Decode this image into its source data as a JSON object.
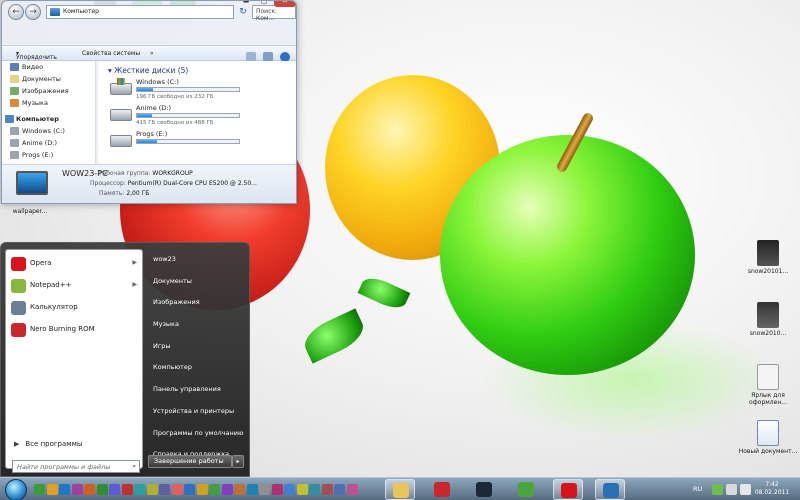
{
  "explorer": {
    "address": "Компьютер",
    "search_placeholder": "Поиск: Ком...",
    "back_glyph": "←",
    "forward_glyph": "→",
    "refresh_glyph": "↻",
    "commands": {
      "organize": "Упорядочить",
      "properties": "Свойства системы",
      "more": "»"
    },
    "nav": {
      "libraries": [
        "Видео",
        "Документы",
        "Изображения",
        "Музыка"
      ],
      "computer_section": "Компьютер",
      "drives": [
        "Windows (C:)",
        "Anime (D:)",
        "Progs (E:)"
      ]
    },
    "group_header": "Жесткие диски (5)",
    "drives": [
      {
        "name": "Windows (C:)",
        "free": "196 ГБ свободно из 232 ГБ",
        "used_fraction": 0.16,
        "icon": "windows-drive-icon"
      },
      {
        "name": "Anime (D:)",
        "free": "415 ГБ свободно из 488 ГБ",
        "used_fraction": 0.15,
        "icon": "hard-drive-icon"
      },
      {
        "name": "Progs (E:)",
        "free": "",
        "used_fraction": 0.2,
        "icon": "hard-drive-icon"
      }
    ],
    "details": {
      "pc_name": "WOW23-PC",
      "workgroup_label": "Рабочая группа:",
      "workgroup": "WORKGROUP",
      "cpu_label": "Процессор:",
      "cpu": "Pentium(R) Dual-Core  CPU    E5200  @ 2.50...",
      "memory_label": "Память:",
      "memory": "2,00 ГБ"
    }
  },
  "desktop_icons": [
    {
      "label": "wallpaper..."
    },
    {
      "label": "snow20101..."
    },
    {
      "label": "snow2010..."
    },
    {
      "label": "Ярлык для оформлен..."
    },
    {
      "label": "Новый документ..."
    }
  ],
  "start_menu": {
    "pinned": [
      {
        "label": "Opera",
        "color": "#d9131b",
        "has_arrow": true
      },
      {
        "label": "Notepad++",
        "color": "#86b83f",
        "has_arrow": true
      },
      {
        "label": "Калькулятор",
        "color": "#6b7f96",
        "has_arrow": false
      },
      {
        "label": "Nero Burning ROM",
        "color": "#c8282d",
        "has_arrow": false
      }
    ],
    "all_programs": "Все программы",
    "all_programs_glyph": "▶",
    "search_placeholder": "Найти программы и файлы",
    "search_glyph": "⌕",
    "right": [
      "wow23",
      "Документы",
      "Изображения",
      "Музыка",
      "Игры",
      "Компьютер",
      "Панель управления",
      "Устройства и принтеры",
      "Программы по умолчанию",
      "Справка и поддержка"
    ],
    "shutdown": "Завершение работы",
    "shutdown_glyph": "▸"
  },
  "taskbar": {
    "pinned_icon_colors": [
      "#3a9b3a",
      "#e0a020",
      "#1e78c8",
      "#a040a0",
      "#d06020",
      "#2f8f2f",
      "#5b5bd6",
      "#c03030",
      "#2aa0a0",
      "#b0b030",
      "#6060a0",
      "#e06060",
      "#3070c0",
      "#d0a020",
      "#40a040",
      "#8040c0",
      "#c07030",
      "#2080b0",
      "#909090",
      "#b03070",
      "#4080d0",
      "#c0c030",
      "#3090a0",
      "#a05050",
      "#5070b0",
      "#c05090"
    ],
    "buttons": [
      {
        "name": "explorer",
        "color": "#e8c45a",
        "active": true
      },
      {
        "name": "filezilla",
        "color": "#c8282d",
        "active": false
      },
      {
        "name": "steam",
        "color": "#1b2838",
        "active": false
      },
      {
        "name": "chrome",
        "color": "#4aa53e",
        "active": false
      },
      {
        "name": "opera",
        "color": "#d9131b",
        "active": true
      },
      {
        "name": "remote-desktop",
        "color": "#2b6fb5",
        "active": true
      }
    ],
    "language": "RU",
    "time": "7:42",
    "date": "08.02.2011"
  }
}
